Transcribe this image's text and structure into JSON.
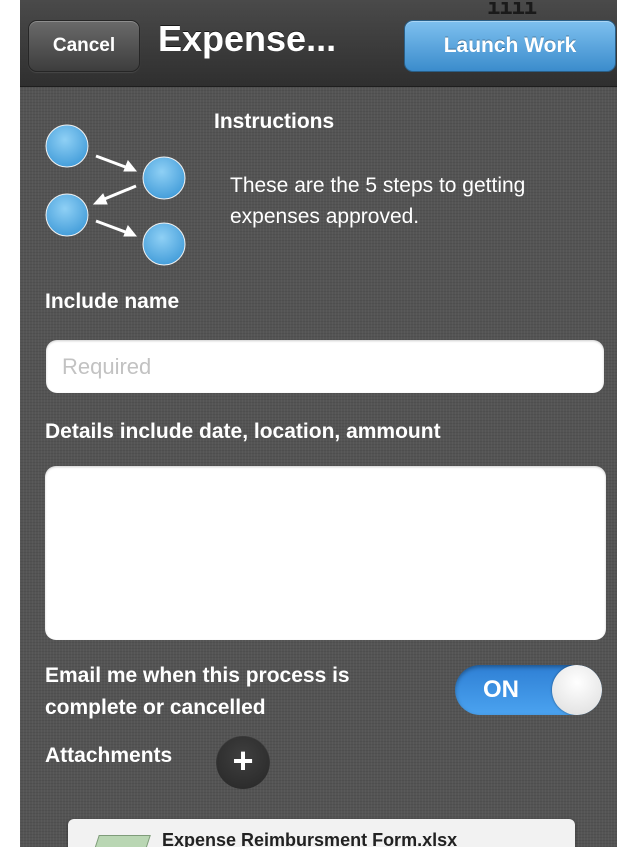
{
  "navbar": {
    "cancel_label": "Cancel",
    "title": "Expense...",
    "launch_label": "Launch Work"
  },
  "instructions": {
    "heading": "Instructions",
    "text": "These are the 5 steps to getting expenses approved.",
    "icon": "process-steps-icon"
  },
  "form": {
    "name_label": "Include name",
    "name_placeholder": "Required",
    "name_value": "",
    "details_label": "Details include date, location, ammount",
    "details_value": "",
    "email_label": "Email me when this process is complete or cancelled",
    "email_toggle_label": "ON",
    "email_toggle_on": true
  },
  "attachments": {
    "label": "Attachments",
    "add_icon": "plus-icon",
    "items": [
      {
        "name": "Expense Reimbursment Form.xlsx",
        "icon": "spreadsheet-file-icon"
      }
    ]
  },
  "colors": {
    "accent": "#3b8ccc",
    "toggle_on": "#3a8fe0",
    "background": "#545454",
    "step_circle": "#5eb2e6"
  }
}
